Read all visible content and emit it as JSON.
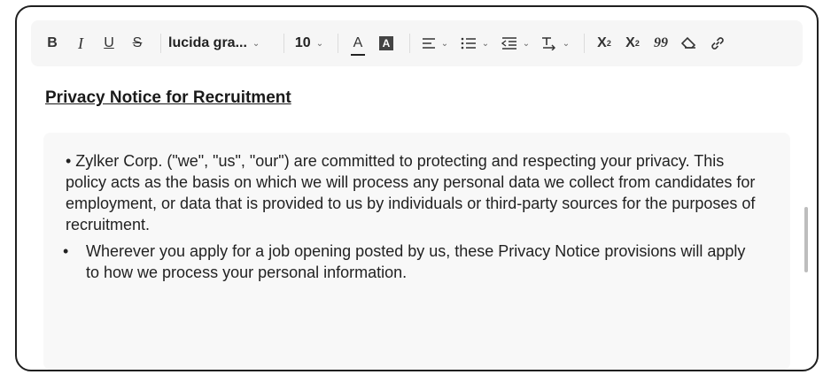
{
  "toolbar": {
    "bold": "B",
    "italic": "I",
    "underline": "U",
    "strike": "S",
    "font_name": "lucida gra...",
    "font_size": "10",
    "font_color_glyph": "A",
    "highlight_glyph": "A",
    "superscript": "X",
    "superscript_mark": "2",
    "subscript": "X",
    "subscript_mark": "2",
    "quote_glyph": "99"
  },
  "document": {
    "heading": "Privacy Notice for Recruitment",
    "paragraph": "• Zylker Corp. (\"we\", \"us\", \"our\") are committed to protecting and respecting your privacy. This policy acts as the basis on which we will process any personal data we collect from candidates for employment, or data that is provided to us by individuals or third-party sources for the purposes of recruitment.",
    "sub_bullet": "•",
    "sub_item": "Wherever you apply for a job opening posted by us, these Privacy Notice provisions will apply to how we process your personal information."
  }
}
